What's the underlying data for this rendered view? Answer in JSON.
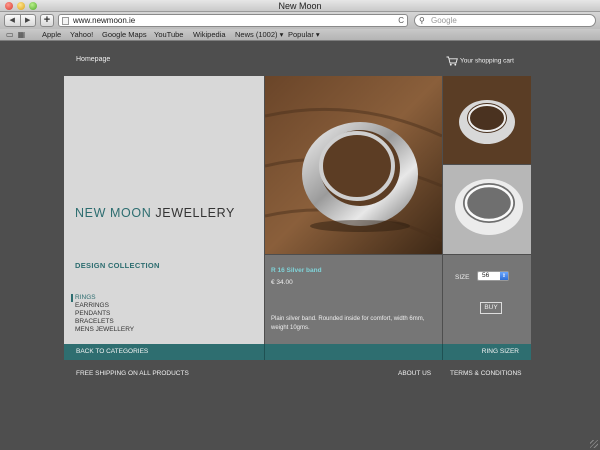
{
  "window": {
    "title": "New Moon"
  },
  "toolbar": {
    "back_glyph": "◀",
    "forward_glyph": "▶",
    "add_glyph": "+",
    "url": "www.newmoon.ie",
    "reload_glyph": "C",
    "search_placeholder": "Google"
  },
  "bookmarks": {
    "items": [
      "Apple",
      "Yahoo!",
      "Google Maps",
      "YouTube",
      "Wikipedia",
      "News (1002) ▾",
      "Popular ▾"
    ]
  },
  "page": {
    "homepage_link": "Homepage",
    "cart_label": "Your shopping cart",
    "brand_part1": "NEW MOON",
    "brand_part2": "JEWELLERY",
    "collection_heading": "DESIGN COLLECTION",
    "categories": [
      "RINGS",
      "EARRINGS",
      "PENDANTS",
      "BRACELETS",
      "MENS JEWELLERY"
    ],
    "active_category": "RINGS",
    "product": {
      "name": "R 16 Silver band",
      "price": "€ 34.00",
      "description": "Plain silver band. Rounded inside for comfort, width 6mm, weight 10gms."
    },
    "options": {
      "size_label": "SIZE",
      "size_value": "56",
      "buy_label": "BUY"
    },
    "nav": {
      "back_to_categories": "BACK TO CATEGORIES",
      "ring_sizer": "RING SIZER"
    },
    "footer": {
      "shipping": "FREE SHIPPING ON ALL PRODUCTS",
      "about": "ABOUT US",
      "terms": "TERMS & CONDITIONS"
    }
  },
  "colors": {
    "accent_teal": "#2e6e70",
    "page_bg": "#4e4e4e",
    "panel_grey": "#767676",
    "product_name": "#7fd3d8"
  }
}
